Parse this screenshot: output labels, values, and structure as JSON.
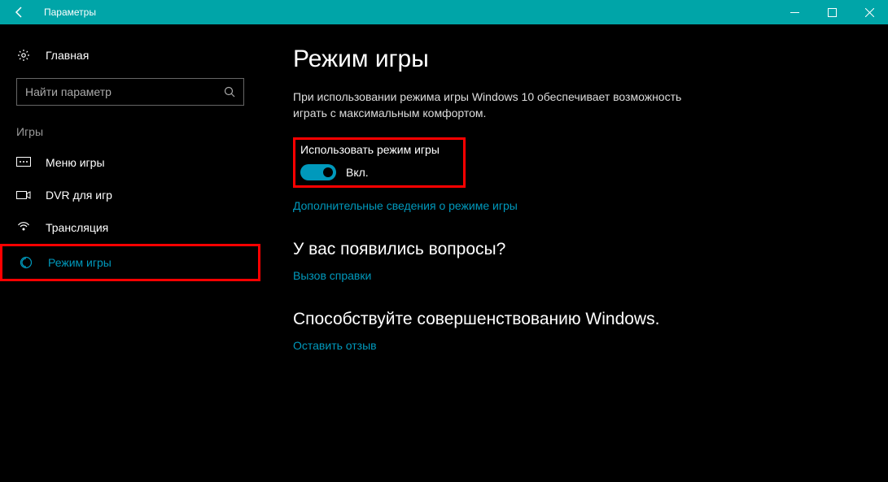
{
  "titlebar": {
    "title": "Параметры"
  },
  "sidebar": {
    "home": "Главная",
    "search_placeholder": "Найти параметр",
    "category": "Игры",
    "items": [
      {
        "label": "Меню игры"
      },
      {
        "label": "DVR для игр"
      },
      {
        "label": "Трансляция"
      },
      {
        "label": "Режим игры"
      }
    ]
  },
  "main": {
    "heading": "Режим игры",
    "description": "При использовании режима игры Windows 10 обеспечивает возможность играть с максимальным комфортом.",
    "toggle": {
      "label": "Использовать режим игры",
      "state": "Вкл."
    },
    "learn_more": "Дополнительные сведения о режиме игры",
    "questions_heading": "У вас появились вопросы?",
    "help_link": "Вызов справки",
    "feedback_heading": "Способствуйте совершенствованию Windows.",
    "feedback_link": "Оставить отзыв"
  }
}
